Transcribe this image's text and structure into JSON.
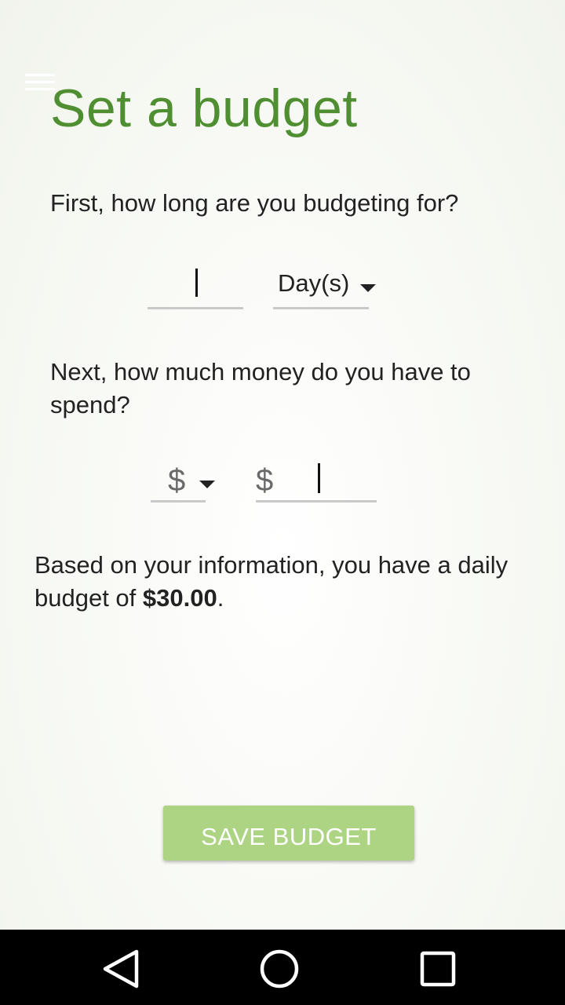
{
  "header": {
    "menu_icon": "hamburger-menu-icon",
    "title": "Set a budget"
  },
  "duration": {
    "question": "First, how long are you budgeting for?",
    "value": "",
    "period_selected": "Day(s)"
  },
  "money": {
    "question": "Next, how much money do you have to spend?",
    "currency_selected": "$",
    "amount_prefix": "$",
    "amount_value": ""
  },
  "result": {
    "prefix": "Based on your information, you have a daily budget of ",
    "amount": "$30.00",
    "suffix": "."
  },
  "actions": {
    "save_label": "SAVE BUDGET"
  },
  "colors": {
    "accent": "#4f8f32",
    "button": "#add483",
    "underline": "#c9c9c9"
  },
  "navigation": {
    "back_icon": "back-triangle-icon",
    "home_icon": "home-circle-icon",
    "recents_icon": "recents-square-icon"
  }
}
